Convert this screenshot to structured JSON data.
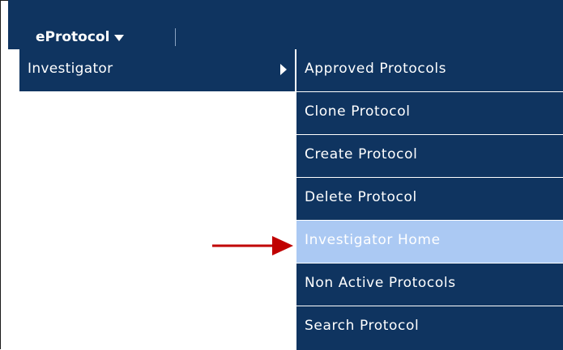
{
  "app": {
    "menu_title": "eProtocol"
  },
  "level1": {
    "item_label": "Investigator"
  },
  "level2": {
    "items": [
      {
        "label": "Approved Protocols"
      },
      {
        "label": "Clone Protocol"
      },
      {
        "label": "Create Protocol"
      },
      {
        "label": "Delete Protocol"
      },
      {
        "label": "Investigator Home"
      },
      {
        "label": "Non Active Protocols"
      },
      {
        "label": "Search Protocol"
      }
    ],
    "highlighted_index": 4
  },
  "icons": {
    "menu_caret": "chevron-down-icon",
    "submenu_arrow": "chevron-right-icon",
    "annotation_arrow": "arrow-right-icon"
  },
  "colors": {
    "menu_bg": "#0f3460",
    "highlight_bg": "#abc9f3",
    "annotation_arrow": "#c00000"
  }
}
